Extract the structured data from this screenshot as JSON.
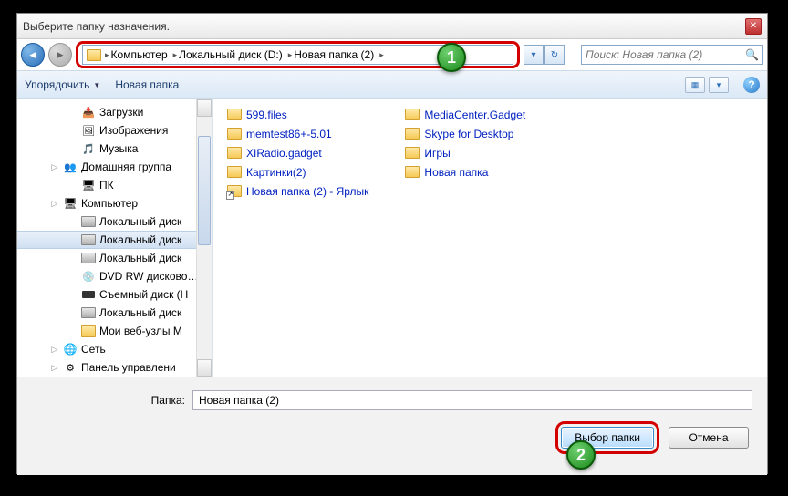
{
  "title": "Выберите папку назначения.",
  "breadcrumb": [
    "Компьютер",
    "Локальный диск (D:)",
    "Новая папка (2)"
  ],
  "search_placeholder": "Поиск: Новая папка (2)",
  "toolbar": {
    "organize": "Упорядочить",
    "new_folder": "Новая папка"
  },
  "tree": [
    {
      "icon": "dl",
      "label": "Загрузки",
      "indent": 56
    },
    {
      "icon": "pic",
      "label": "Изображения",
      "indent": 56
    },
    {
      "icon": "music",
      "label": "Музыка",
      "indent": 56
    },
    {
      "icon": "grp",
      "label": "Домашняя группа",
      "indent": 36,
      "exp": true
    },
    {
      "icon": "pc",
      "label": "ПК",
      "indent": 56
    },
    {
      "icon": "pc",
      "label": "Компьютер",
      "indent": 36,
      "exp": true
    },
    {
      "icon": "disk",
      "label": "Локальный диск",
      "indent": 56
    },
    {
      "icon": "disk",
      "label": "Локальный диск",
      "indent": 56,
      "sel": true
    },
    {
      "icon": "disk",
      "label": "Локальный диск",
      "indent": 56
    },
    {
      "icon": "dvd",
      "label": "DVD RW дисково…",
      "indent": 56
    },
    {
      "icon": "rem",
      "label": "Съемный диск (H",
      "indent": 56
    },
    {
      "icon": "disk",
      "label": "Локальный диск",
      "indent": 56
    },
    {
      "icon": "folder",
      "label": "Мои веб-узлы M",
      "indent": 56
    },
    {
      "icon": "net",
      "label": "Сеть",
      "indent": 36,
      "exp": true
    },
    {
      "icon": "ctrl",
      "label": "Панель управлени",
      "indent": 36,
      "exp": true
    }
  ],
  "files_col1": [
    {
      "name": "599.files"
    },
    {
      "name": "memtest86+-5.01"
    },
    {
      "name": "XIRadio.gadget"
    },
    {
      "name": "Картинки(2)"
    },
    {
      "name": "Новая папка (2) - Ярлык",
      "shortcut": true
    }
  ],
  "files_col2": [
    {
      "name": "MediaCenter.Gadget"
    },
    {
      "name": "Skype for Desktop"
    },
    {
      "name": "Игры"
    },
    {
      "name": "Новая папка"
    }
  ],
  "footer": {
    "label": "Папка:",
    "value": "Новая папка (2)",
    "select": "Выбор папки",
    "cancel": "Отмена"
  },
  "markers": {
    "m1": "1",
    "m2": "2"
  }
}
